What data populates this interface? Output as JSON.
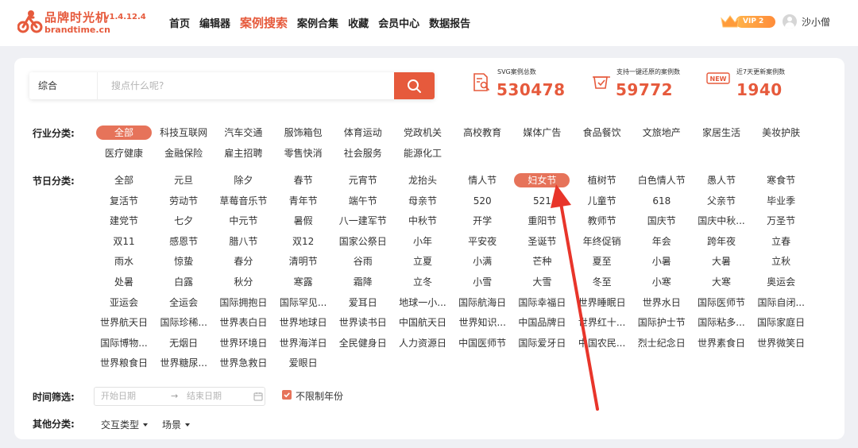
{
  "header": {
    "logo_cn": "品牌时光机",
    "logo_en": "brandtime.cn",
    "version": "v1.4.12.4",
    "nav": [
      {
        "label": "首页",
        "active": false
      },
      {
        "label": "编辑器",
        "active": false
      },
      {
        "label": "案例搜索",
        "active": true
      },
      {
        "label": "案例合集",
        "active": false
      },
      {
        "label": "收藏",
        "active": false
      },
      {
        "label": "会员中心",
        "active": false
      },
      {
        "label": "数据报告",
        "active": false
      }
    ],
    "vip_label": "VIP 2",
    "username": "沙小僧"
  },
  "search": {
    "type": "综合",
    "placeholder": "搜点什么呢?"
  },
  "stats": [
    {
      "label": "SVG案例总数",
      "value": "530478",
      "icon": "document-search-icon"
    },
    {
      "label": "支持一键还原的案例数",
      "value": "59772",
      "icon": "restore-icon"
    },
    {
      "label": "近7天更新案例数",
      "value": "1940",
      "icon": "new-badge-icon",
      "badge": "NEW"
    }
  ],
  "industry": {
    "label": "行业分类:",
    "items": [
      "全部",
      "科技互联网",
      "汽车交通",
      "服饰箱包",
      "体育运动",
      "党政机关",
      "高校教育",
      "媒体广告",
      "食品餐饮",
      "文旅地产",
      "家居生活",
      "美妆护肤",
      "医疗健康",
      "金融保险",
      "雇主招聘",
      "零售快消",
      "社会服务",
      "能源化工"
    ],
    "active": "全部"
  },
  "holiday": {
    "label": "节日分类:",
    "items": [
      "全部",
      "元旦",
      "除夕",
      "春节",
      "元宵节",
      "龙抬头",
      "情人节",
      "妇女节",
      "植树节",
      "白色情人节",
      "愚人节",
      "寒食节",
      "复活节",
      "劳动节",
      "草莓音乐节",
      "青年节",
      "端午节",
      "母亲节",
      "520",
      "521",
      "儿童节",
      "618",
      "父亲节",
      "毕业季",
      "建党节",
      "七夕",
      "中元节",
      "暑假",
      "八一建军节",
      "中秋节",
      "开学",
      "重阳节",
      "教师节",
      "国庆节",
      "国庆中秋...",
      "万圣节",
      "双11",
      "感恩节",
      "腊八节",
      "双12",
      "国家公祭日",
      "小年",
      "平安夜",
      "圣诞节",
      "年终促销",
      "年会",
      "跨年夜",
      "立春",
      "雨水",
      "惊蛰",
      "春分",
      "清明节",
      "谷雨",
      "立夏",
      "小满",
      "芒种",
      "夏至",
      "小暑",
      "大暑",
      "立秋",
      "处暑",
      "白露",
      "秋分",
      "寒露",
      "霜降",
      "立冬",
      "小雪",
      "大雪",
      "冬至",
      "小寒",
      "大寒",
      "奥运会",
      "亚运会",
      "全运会",
      "国际拥抱日",
      "国际罕见...",
      "爱耳日",
      "地球一小...",
      "国际航海日",
      "国际幸福日",
      "世界睡眠日",
      "世界水日",
      "国际医师节",
      "国际自闭...",
      "世界航天日",
      "国际珍稀...",
      "世界表白日",
      "世界地球日",
      "世界读书日",
      "中国航天日",
      "世界知识...",
      "中国品牌日",
      "世界红十...",
      "国际护士节",
      "国际粘多...",
      "国际家庭日",
      "国际博物...",
      "无烟日",
      "世界环境日",
      "世界海洋日",
      "全民健身日",
      "人力资源日",
      "中国医师节",
      "国际爱牙日",
      "中国农民...",
      "烈士纪念日",
      "世界素食日",
      "世界微笑日",
      "世界粮食日",
      "世界糖尿...",
      "世界急救日",
      "爱眼日"
    ],
    "active": "妇女节"
  },
  "time_filter": {
    "label": "时间筛选:",
    "start_placeholder": "开始日期",
    "arrow": "→",
    "end_placeholder": "结束日期",
    "no_limit_label": "不限制年份",
    "no_limit_checked": true
  },
  "other": {
    "label": "其他分类:",
    "dropdowns": [
      "交互类型",
      "场景"
    ]
  },
  "colors": {
    "accent": "#e65a3c",
    "active_tag": "#e6735a",
    "annotation_arrow": "#e8352a"
  }
}
